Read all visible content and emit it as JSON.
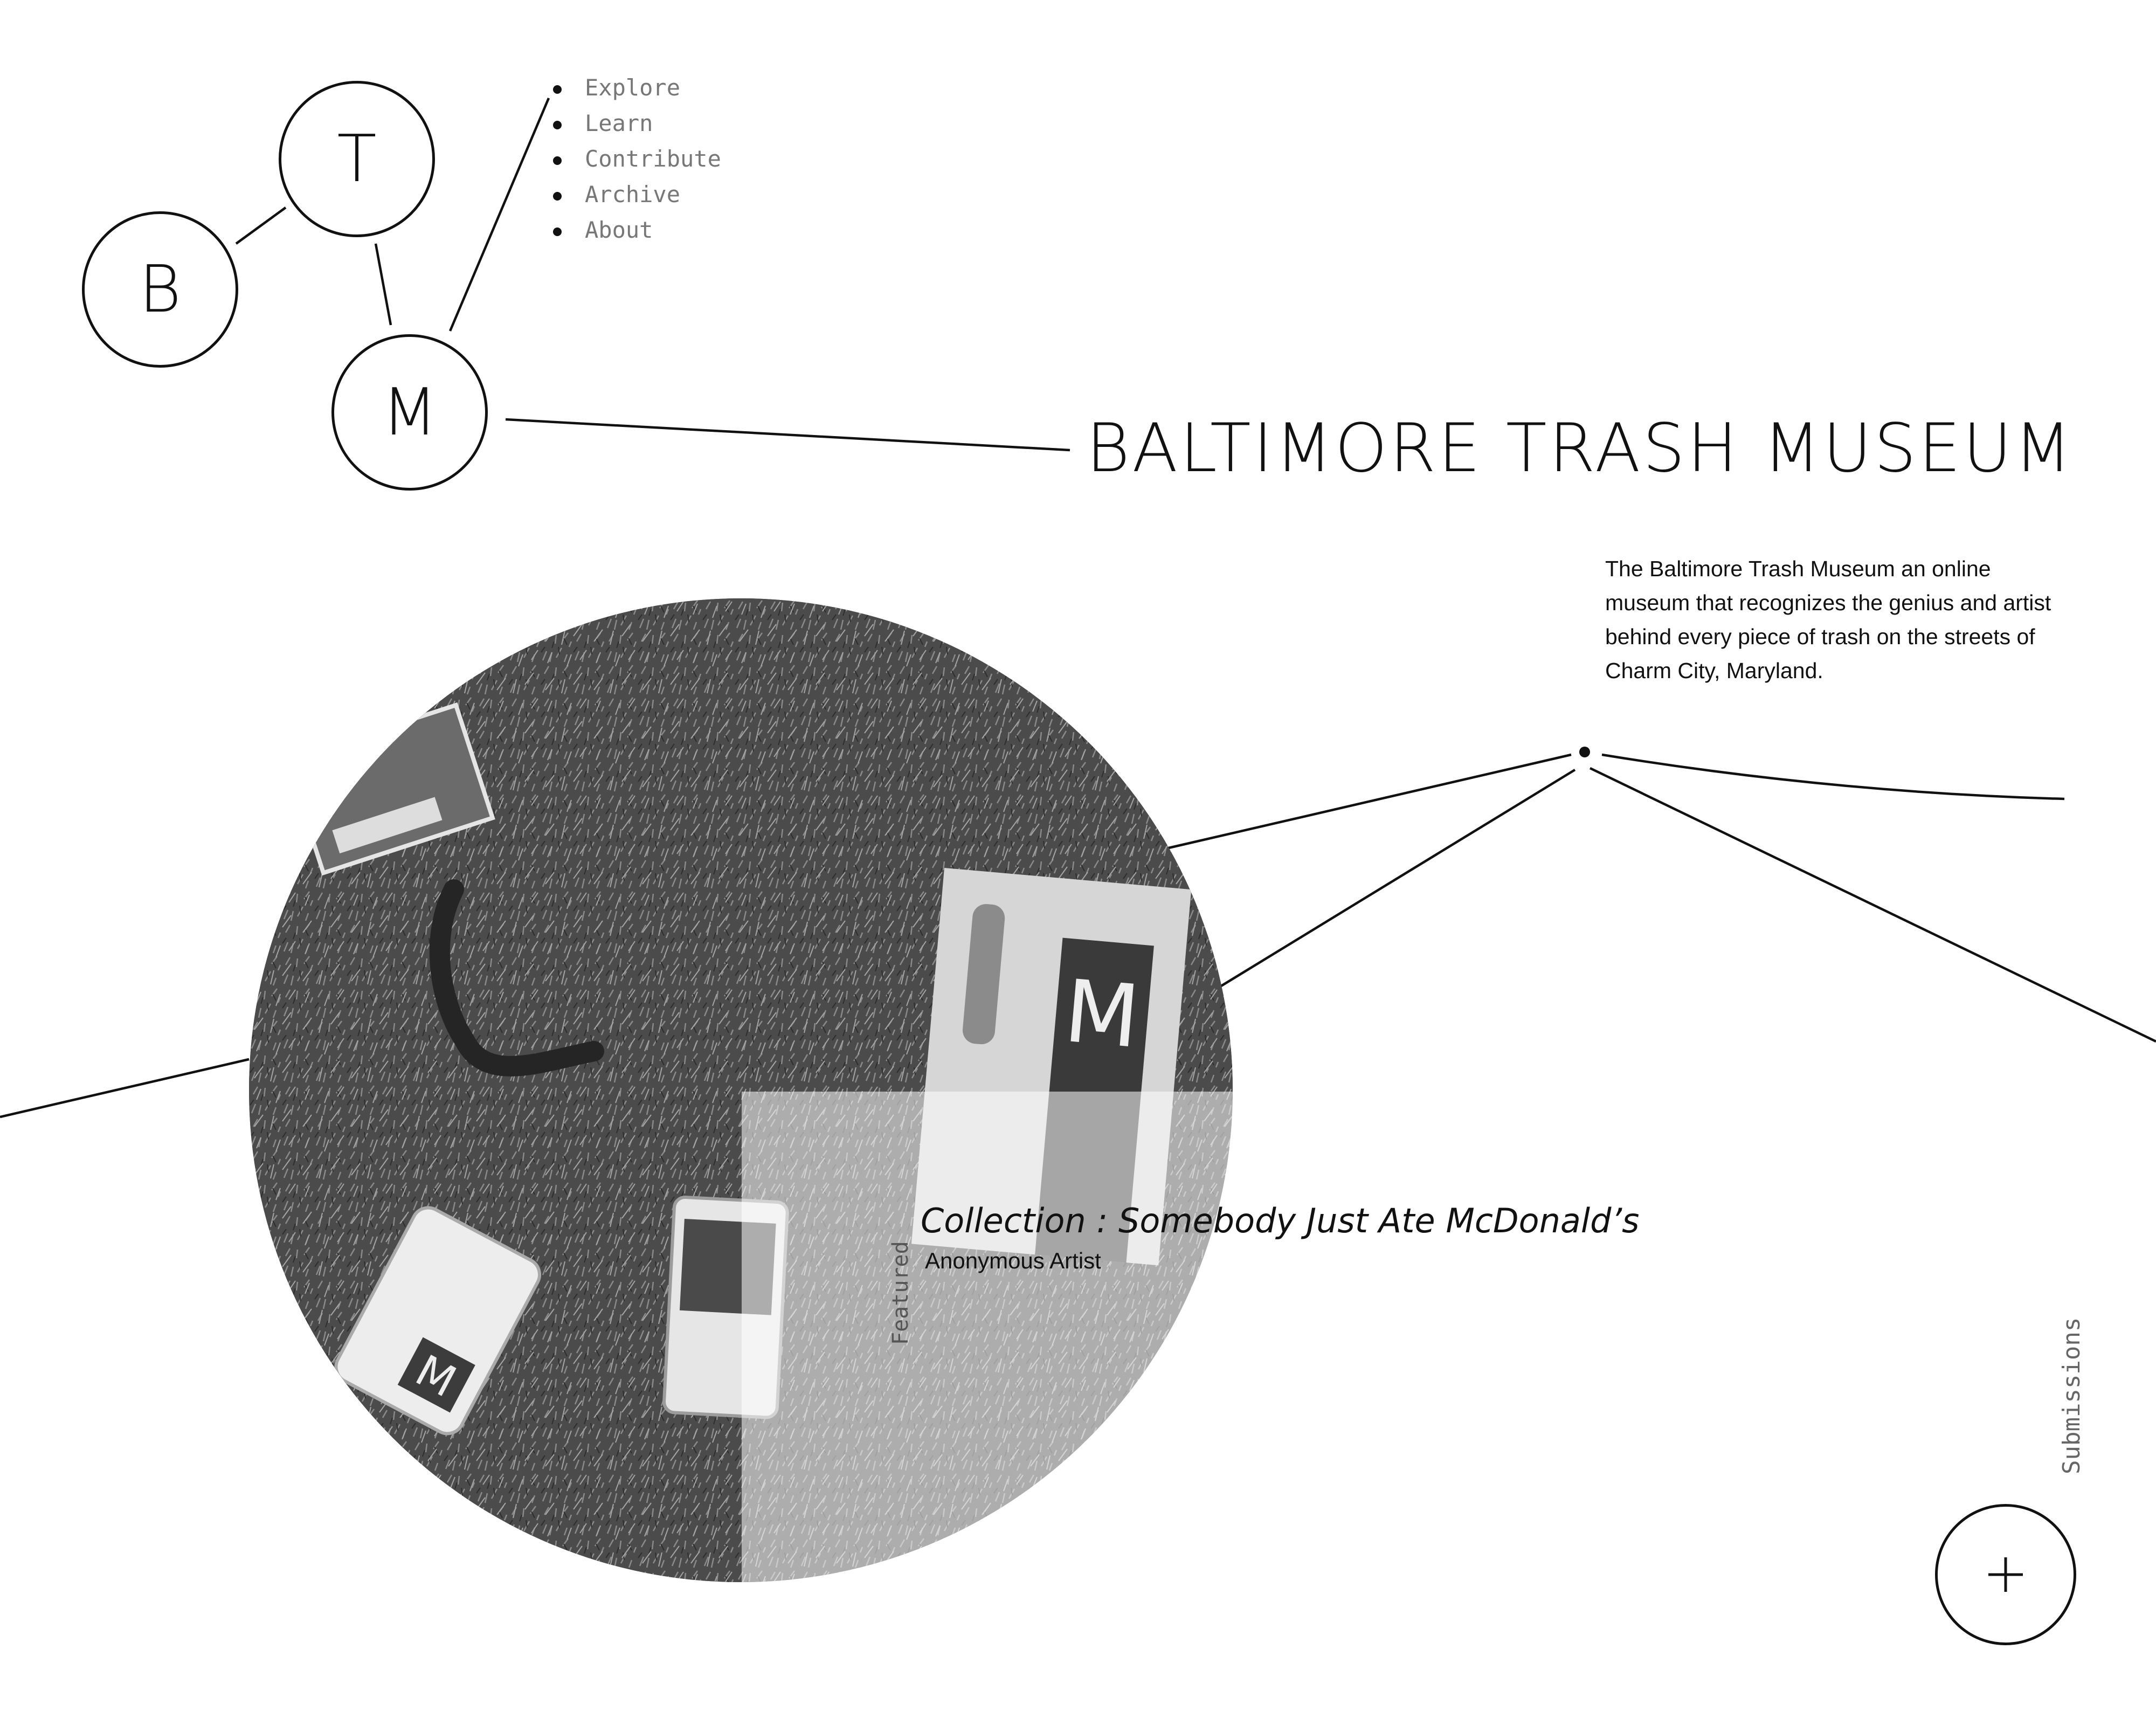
{
  "logo": {
    "letter_b": "B",
    "letter_t": "T",
    "letter_m": "M"
  },
  "nav": {
    "items": [
      {
        "label": "Explore"
      },
      {
        "label": "Learn"
      },
      {
        "label": "Contribute"
      },
      {
        "label": "Archive"
      },
      {
        "label": "About"
      }
    ]
  },
  "site": {
    "title": "BALTIMORE TRASH MUSEUM",
    "description": "The Baltimore Trash Museum an online museum that recognizes the genius and artist behind every piece of trash on the streets of Charm City, Maryland."
  },
  "featured": {
    "label": "Featured",
    "collection_title": "Collection : Somebody Just Ate McDonald’s",
    "artist": "Anonymous Artist"
  },
  "submissions": {
    "label": "Submissions",
    "add_icon": "plus-icon"
  },
  "colors": {
    "ink": "#111111",
    "nav_text": "#777777",
    "background": "#ffffff"
  }
}
